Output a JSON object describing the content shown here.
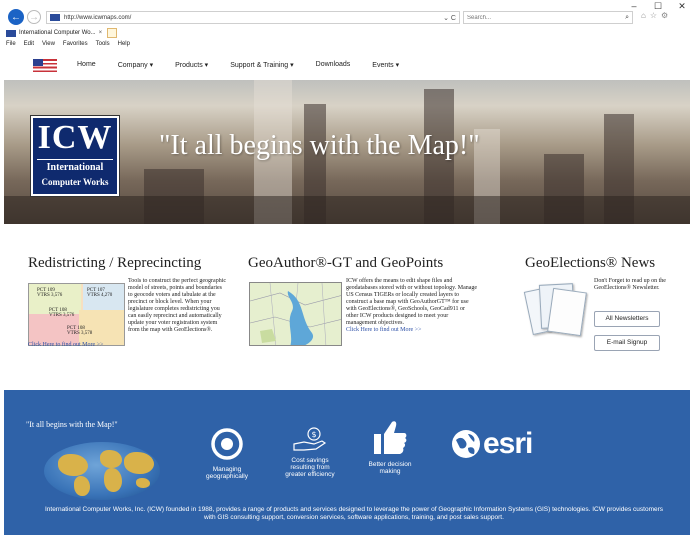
{
  "browser": {
    "window_controls": [
      "–",
      "☐",
      "✕"
    ],
    "url": "http://www.icwmaps.com/",
    "address_icons": "⌄ C",
    "search_placeholder": "Search...",
    "tab_title": "International Computer Wo...",
    "menu": [
      "File",
      "Edit",
      "View",
      "Favorites",
      "Tools",
      "Help"
    ]
  },
  "nav": {
    "items": [
      "Home",
      "Company ▾",
      "Products ▾",
      "Support & Training ▾",
      "Downloads",
      "Events ▾"
    ]
  },
  "hero": {
    "logo_main": "ICW",
    "logo_line1": "International",
    "logo_line2": "Computer Works",
    "tagline": "\"It all begins with the Map!\""
  },
  "columns": {
    "redistricting": {
      "title": "Redistricting / Reprecincting",
      "text": "Tools to construct the perfect geographic model of streets, points and boundaries to geocode voters and tabulate at the precinct or block level. When your legislature completes redistricting you can easily reprecinct and automatically update your voter registration system from the map with GeoElections®.",
      "link": "Click Here to find out More >>",
      "map_labels": [
        "PCT 109\nVTRS 3,576",
        "PCT 107\nVTRS 4,270",
        "PCT 108\nVTRS 3,576",
        "PCT 108\nVTRS 3,578"
      ]
    },
    "geoauthor": {
      "title": "GeoAuthor®-GT and GeoPoints",
      "text": "ICW offers the means to edit shape files and geodatabases stored with or without topology. Manage US Census TIGERs or locally created layers to construct a base map with GeoAuthorGT™ for use with GeoElections®, GeoSchools, GeoCad911 or other ICW products designed to meet your management objectives.",
      "link": "Click Here to find out More >>"
    },
    "news": {
      "title": "GeoElections® News",
      "text": "Don't Forget to read up on the GeoElections® Newsletter.",
      "btn_newsletters": "All Newsletters",
      "btn_signup": "E-mail Signup"
    }
  },
  "band": {
    "quote": "\"It all begins with the Map!\"",
    "features": [
      {
        "label": "Managing geographically",
        "icon": "target-icon"
      },
      {
        "label": "Cost savings resulting from greater efficiency",
        "icon": "money-hand-icon"
      },
      {
        "label": "Better decision making",
        "icon": "thumbs-up-icon"
      }
    ],
    "esri": "esri",
    "text": "International Computer Works, Inc. (ICW) founded in 1988, provides a range of products and services designed to leverage the power of Geographic Information Systems (GIS) technologies. ICW provides customers with GIS consulting support, conversion services, software applications, training, and post sales support."
  }
}
